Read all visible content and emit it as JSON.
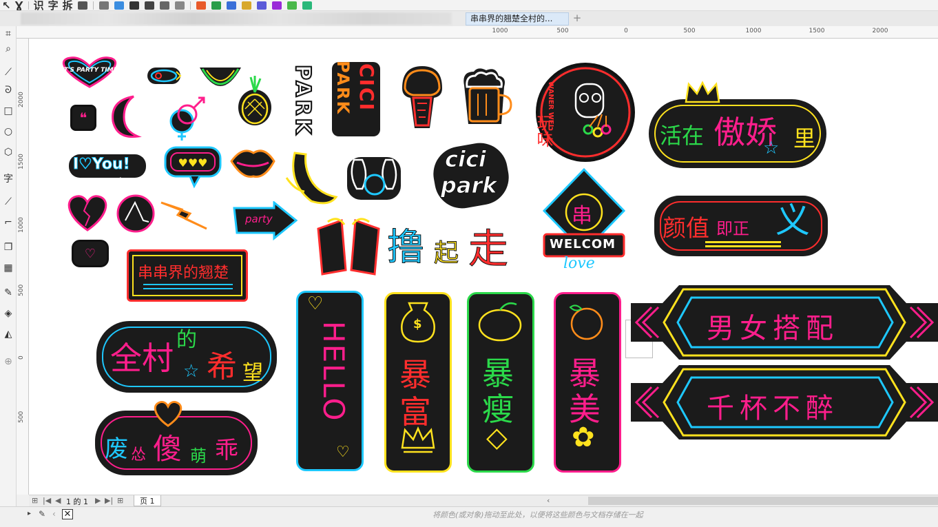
{
  "toolbar": {
    "items": [
      "识",
      "字",
      "拆"
    ]
  },
  "tabs": {
    "document_title": "串串界的翘楚全村的...",
    "new_tab": "+"
  },
  "toolbox": {
    "text_tool": "字"
  },
  "ruler": {
    "h_labels": [
      "1000",
      "500",
      "0",
      "500",
      "1000",
      "1500",
      "2000"
    ],
    "v_labels": [
      "2000",
      "1500",
      "1000",
      "500",
      "0",
      "500"
    ]
  },
  "stickers": {
    "party_time": "IT'S PARTY TIME",
    "park": "PARK",
    "cici_vertical": "CICI",
    "wanwei": "WANER WEI",
    "wanwei_cn": "玩味",
    "huo_zai": "活在",
    "ao_jiao": "傲娇",
    "li": "里",
    "i_love_you": "I♡You!",
    "cici_park_1": "cici",
    "cici_park_2": "park",
    "chuan": "串",
    "welcom": "WELCOM",
    "love": "love",
    "party": "party",
    "yan_zhi": "颜值",
    "ji_zheng": "即正",
    "yi": "义",
    "lu_qi_zou_1": "撸",
    "lu_qi_zou_2": "起",
    "lu_qi_zou_3": "走",
    "chuan_jie": "串串界的翘楚",
    "hello": "HELLO",
    "bao_fu_1": "暴",
    "bao_fu_2": "富",
    "bao_shou_1": "暴",
    "bao_shou_2": "瘦",
    "bao_mei_1": "暴",
    "bao_mei_2": "美",
    "nan_nv": "男女搭配",
    "qian_bei": "千杯不醉",
    "quan_cun": "全村",
    "de": "的",
    "xi_wang_1": "希",
    "xi_wang_2": "望",
    "fei_1": "废",
    "fei_2": "怂",
    "fei_3": "傻",
    "fei_4": "萌",
    "fei_5": "乖",
    "dollar": "$"
  },
  "pagebar": {
    "page_info": "1 的 1",
    "page_tab": "页 1"
  },
  "status": {
    "hint": "将颜色(或对象)拖动至此处，以便将这些颜色与文档存储在一起"
  },
  "colors": {
    "neon_pink": "#ff1e8c",
    "neon_blue": "#1ec8ff",
    "neon_yellow": "#ffe21e",
    "neon_green": "#2bd94a",
    "neon_red": "#ff2d2d",
    "neon_orange": "#ff8c1a",
    "sticker_bg": "#1b1b1b"
  }
}
